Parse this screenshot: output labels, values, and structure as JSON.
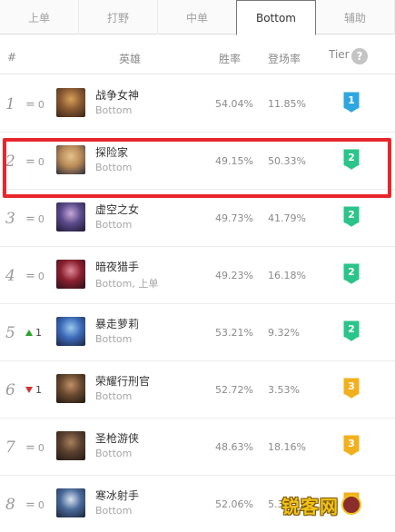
{
  "tabs": [
    {
      "label": "上单",
      "active": false
    },
    {
      "label": "打野",
      "active": false
    },
    {
      "label": "中单",
      "active": false
    },
    {
      "label": "Bottom",
      "active": true
    },
    {
      "label": "辅助",
      "active": false
    }
  ],
  "header": {
    "rank": "#",
    "hero": "英雄",
    "win_rate": "胜率",
    "pick_rate": "登场率",
    "tier": "Tier",
    "help_symbol": "?"
  },
  "rows": [
    {
      "rank": "1",
      "change_type": "same",
      "change": "0",
      "name": "战争女神",
      "role": "Bottom",
      "win": "54.04%",
      "pick": "11.85%",
      "tier": "1",
      "tier_color": "#2ea7e0",
      "avatar": [
        "#3a2418",
        "#8a5a32",
        "#d9a05b"
      ]
    },
    {
      "rank": "2",
      "change_type": "same",
      "change": "0",
      "name": "探险家",
      "role": "Bottom",
      "win": "49.15%",
      "pick": "50.33%",
      "tier": "2",
      "tier_color": "#2bc48a",
      "avatar": [
        "#2b2a3a",
        "#b78a58",
        "#e6c28b"
      ]
    },
    {
      "rank": "3",
      "change_type": "same",
      "change": "0",
      "name": "虚空之女",
      "role": "Bottom",
      "win": "49.73%",
      "pick": "41.79%",
      "tier": "2",
      "tier_color": "#2bc48a",
      "avatar": [
        "#1e1830",
        "#5a4a8a",
        "#c7a7d8"
      ]
    },
    {
      "rank": "4",
      "change_type": "same",
      "change": "0",
      "name": "暗夜猎手",
      "role": "Bottom, 上单",
      "win": "49.23%",
      "pick": "16.18%",
      "tier": "2",
      "tier_color": "#2bc48a",
      "avatar": [
        "#2a1018",
        "#8a2030",
        "#e08a9a"
      ]
    },
    {
      "rank": "5",
      "change_type": "up",
      "change": "1",
      "name": "暴走萝莉",
      "role": "Bottom",
      "win": "53.21%",
      "pick": "9.32%",
      "tier": "2",
      "tier_color": "#2bc48a",
      "avatar": [
        "#1a2440",
        "#3c6ab8",
        "#9ac8ee"
      ]
    },
    {
      "rank": "6",
      "change_type": "down",
      "change": "1",
      "name": "荣耀行刑官",
      "role": "Bottom",
      "win": "52.72%",
      "pick": "3.53%",
      "tier": "3",
      "tier_color": "#f2b01e",
      "avatar": [
        "#201812",
        "#6a4a30",
        "#c09068"
      ]
    },
    {
      "rank": "7",
      "change_type": "same",
      "change": "0",
      "name": "圣枪游侠",
      "role": "Bottom",
      "win": "48.63%",
      "pick": "18.16%",
      "tier": "3",
      "tier_color": "#f2b01e",
      "avatar": [
        "#241a14",
        "#5a4030",
        "#a8805a"
      ]
    },
    {
      "rank": "8",
      "change_type": "same",
      "change": "0",
      "name": "寒冰射手",
      "role": "Bottom",
      "win": "52.06%",
      "pick": "5.3",
      "tier": "3",
      "tier_color": "#f2b01e",
      "avatar": [
        "#1a2438",
        "#4a6a9a",
        "#d8e4f0"
      ]
    }
  ],
  "watermark": {
    "text": "锐客网"
  }
}
